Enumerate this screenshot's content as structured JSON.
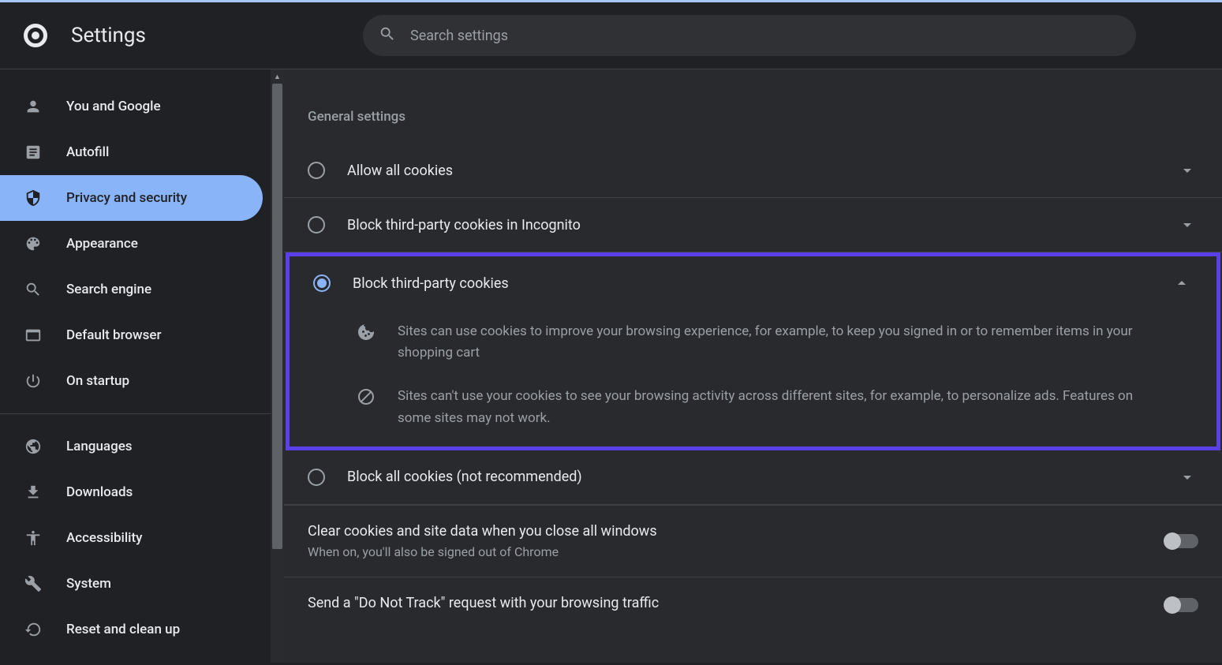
{
  "header": {
    "title": "Settings",
    "search_placeholder": "Search settings"
  },
  "sidebar": {
    "items": [
      {
        "label": "You and Google",
        "icon": "person"
      },
      {
        "label": "Autofill",
        "icon": "autofill"
      },
      {
        "label": "Privacy and security",
        "icon": "shield",
        "active": true
      },
      {
        "label": "Appearance",
        "icon": "palette"
      },
      {
        "label": "Search engine",
        "icon": "search"
      },
      {
        "label": "Default browser",
        "icon": "browser"
      },
      {
        "label": "On startup",
        "icon": "power"
      },
      {
        "label": "Languages",
        "icon": "globe"
      },
      {
        "label": "Downloads",
        "icon": "download"
      },
      {
        "label": "Accessibility",
        "icon": "accessibility"
      },
      {
        "label": "System",
        "icon": "wrench"
      },
      {
        "label": "Reset and clean up",
        "icon": "reset"
      }
    ]
  },
  "content": {
    "section_title": "General settings",
    "radio_options": [
      {
        "label": "Allow all cookies"
      },
      {
        "label": "Block third-party cookies in Incognito"
      },
      {
        "label": "Block third-party cookies",
        "selected": true,
        "expanded": true
      },
      {
        "label": "Block all cookies (not recommended)"
      }
    ],
    "details": [
      "Sites can use cookies to improve your browsing experience, for example, to keep you signed in or to remember items in your shopping cart",
      "Sites can't use your cookies to see your browsing activity across different sites, for example, to personalize ads. Features on some sites may not work."
    ],
    "toggles": [
      {
        "title": "Clear cookies and site data when you close all windows",
        "subtitle": "When on, you'll also be signed out of Chrome"
      },
      {
        "title": "Send a \"Do Not Track\" request with your browsing traffic"
      }
    ]
  }
}
